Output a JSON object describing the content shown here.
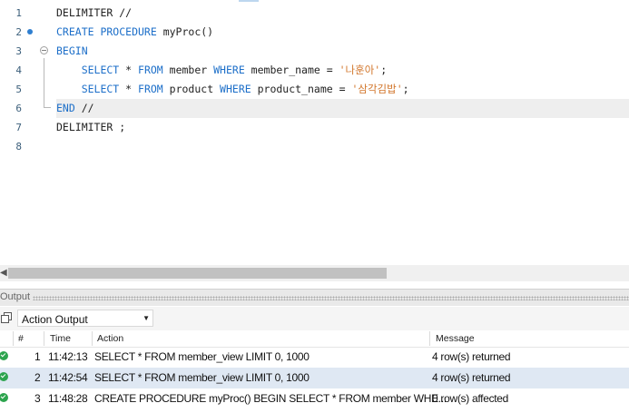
{
  "editor": {
    "lines": [
      {
        "num": "1",
        "seg": [
          {
            "t": "DELIMITER //",
            "c": "plain"
          }
        ]
      },
      {
        "num": "2",
        "seg": [
          {
            "t": "CREATE PROCEDURE",
            "c": "kw"
          },
          {
            "t": " myProc()",
            "c": "plain"
          }
        ]
      },
      {
        "num": "3",
        "seg": [
          {
            "t": "BEGIN",
            "c": "kw"
          }
        ]
      },
      {
        "num": "4",
        "seg": [
          {
            "t": "    SELECT",
            "c": "kw"
          },
          {
            "t": " * ",
            "c": "plain"
          },
          {
            "t": "FROM",
            "c": "kw"
          },
          {
            "t": " member ",
            "c": "plain"
          },
          {
            "t": "WHERE",
            "c": "kw"
          },
          {
            "t": " member_name = ",
            "c": "plain"
          },
          {
            "t": "'나훈아'",
            "c": "str"
          },
          {
            "t": ";",
            "c": "plain"
          }
        ]
      },
      {
        "num": "5",
        "seg": [
          {
            "t": "    SELECT",
            "c": "kw"
          },
          {
            "t": " * ",
            "c": "plain"
          },
          {
            "t": "FROM",
            "c": "kw"
          },
          {
            "t": " product ",
            "c": "plain"
          },
          {
            "t": "WHERE",
            "c": "kw"
          },
          {
            "t": " product_name = ",
            "c": "plain"
          },
          {
            "t": "'삼각김밥'",
            "c": "str"
          },
          {
            "t": ";",
            "c": "plain"
          }
        ]
      },
      {
        "num": "6",
        "seg": [
          {
            "t": "END",
            "c": "kw"
          },
          {
            "t": " //",
            "c": "plain"
          }
        ]
      },
      {
        "num": "7",
        "seg": [
          {
            "t": "DELIMITER ;",
            "c": "plain"
          }
        ]
      },
      {
        "num": "8",
        "seg": []
      }
    ]
  },
  "output": {
    "title": "Output",
    "select_value": "Action Output",
    "columns": {
      "num": "#",
      "time": "Time",
      "action": "Action",
      "message": "Message"
    },
    "rows": [
      {
        "num": "1",
        "time": "11:42:13",
        "action": "SELECT * FROM member_view LIMIT 0, 1000",
        "message": "4 row(s) returned"
      },
      {
        "num": "2",
        "time": "11:42:54",
        "action": "SELECT * FROM member_view LIMIT 0, 1000",
        "message": "4 row(s) returned"
      },
      {
        "num": "3",
        "time": "11:48:28",
        "action": "CREATE PROCEDURE myProc()  BEGIN  SELECT * FROM member WHE...",
        "message": "0 row(s) affected"
      }
    ]
  },
  "colors": {
    "keyword": "#1d6fc9",
    "string": "#d2762b",
    "success": "#2da44e",
    "selected_row": "#dfe8f3"
  }
}
